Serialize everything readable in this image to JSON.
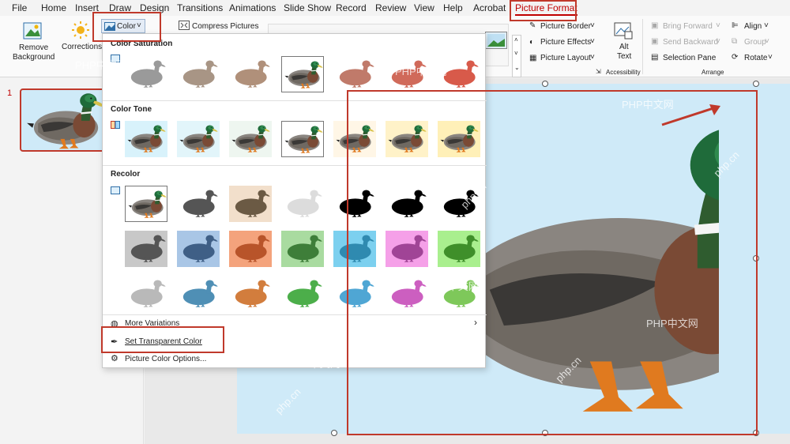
{
  "menubar": {
    "items": [
      "File",
      "Home",
      "Insert",
      "Draw",
      "Design",
      "Transitions",
      "Animations",
      "Slide Show",
      "Record",
      "Review",
      "View",
      "Help",
      "Acrobat",
      "Picture Format"
    ]
  },
  "ribbon": {
    "remove_bg_line1": "Remove",
    "remove_bg_line2": "Background",
    "corrections": "Corrections",
    "color": "Color",
    "compress": "Compress Pictures",
    "picture_border": "Picture Border",
    "picture_effects": "Picture Effects",
    "picture_layout": "Picture Layout",
    "alt_text_line1": "Alt",
    "alt_text_line2": "Text",
    "accessibility": "Accessibility",
    "bring_forward": "Bring Forward",
    "send_backward": "Send Backward",
    "selection_pane": "Selection Pane",
    "align": "Align",
    "group": "Group",
    "rotate": "Rotate",
    "arrange": "Arrange"
  },
  "slides": {
    "current_number": "1"
  },
  "dropdown": {
    "color_saturation": "Color Saturation",
    "color_tone": "Color Tone",
    "recolor": "Recolor",
    "more_variations": "More Variations",
    "set_transparent": "Set Transparent Color",
    "picture_color_options": "Picture Color Options...",
    "saturation_tints": [
      "#9a9a9a",
      "#a89585",
      "#b0907a",
      "#b08a70",
      "#c07a6a",
      "#d06a5a",
      "#d85a4a"
    ],
    "tone_tints": [
      "#d8f2fb",
      "#e2f5fa",
      "#eef6f0",
      "#ffffff",
      "#fff6e6",
      "#fff2c8",
      "#fff0b8"
    ],
    "recolor_rows": [
      [
        "#ffffff",
        "#ffffff",
        "#f2dfcb",
        "#ffffff",
        "#ffffff",
        "#ffffff",
        "#ffffff"
      ],
      [
        "#c8c8c8",
        "#a9c6e6",
        "#f4a37c",
        "#a9dba0",
        "#7cd0ef",
        "#f5a0e8",
        "#a9ef8e"
      ],
      [
        "#ffffff",
        "#ffffff",
        "#ffffff",
        "#ffffff",
        "#ffffff",
        "#ffffff",
        "#ffffff"
      ]
    ],
    "recolor_duck_colors": [
      [
        "natural",
        "#555555",
        "#6b5a44",
        "#dcdcdc",
        "#000000",
        "#000000",
        "#000000"
      ],
      [
        "#555555",
        "#3f5f86",
        "#b8542a",
        "#3e7e39",
        "#2f8ab0",
        "#a04496",
        "#3f8f2a"
      ],
      [
        "#b9b9b9",
        "#4f8fb5",
        "#d27d3d",
        "#4cae4a",
        "#4fa6d4",
        "#cc5fc0",
        "#7ec85a"
      ]
    ]
  },
  "watermarks": [
    "PHP中文网",
    "php.cn"
  ]
}
